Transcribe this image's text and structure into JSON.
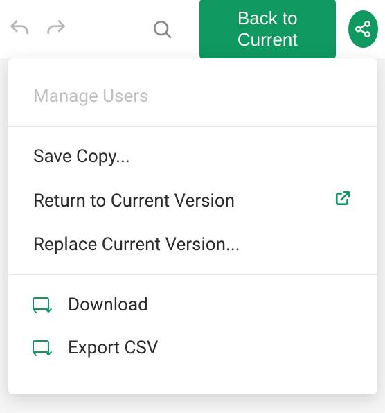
{
  "toolbar": {
    "back_label": "Back to Current"
  },
  "menu": {
    "manage_users": "Manage Users",
    "save_copy": "Save Copy...",
    "return_current": "Return to Current Version",
    "replace_current": "Replace Current Version...",
    "download": "Download",
    "export_csv": "Export CSV"
  }
}
